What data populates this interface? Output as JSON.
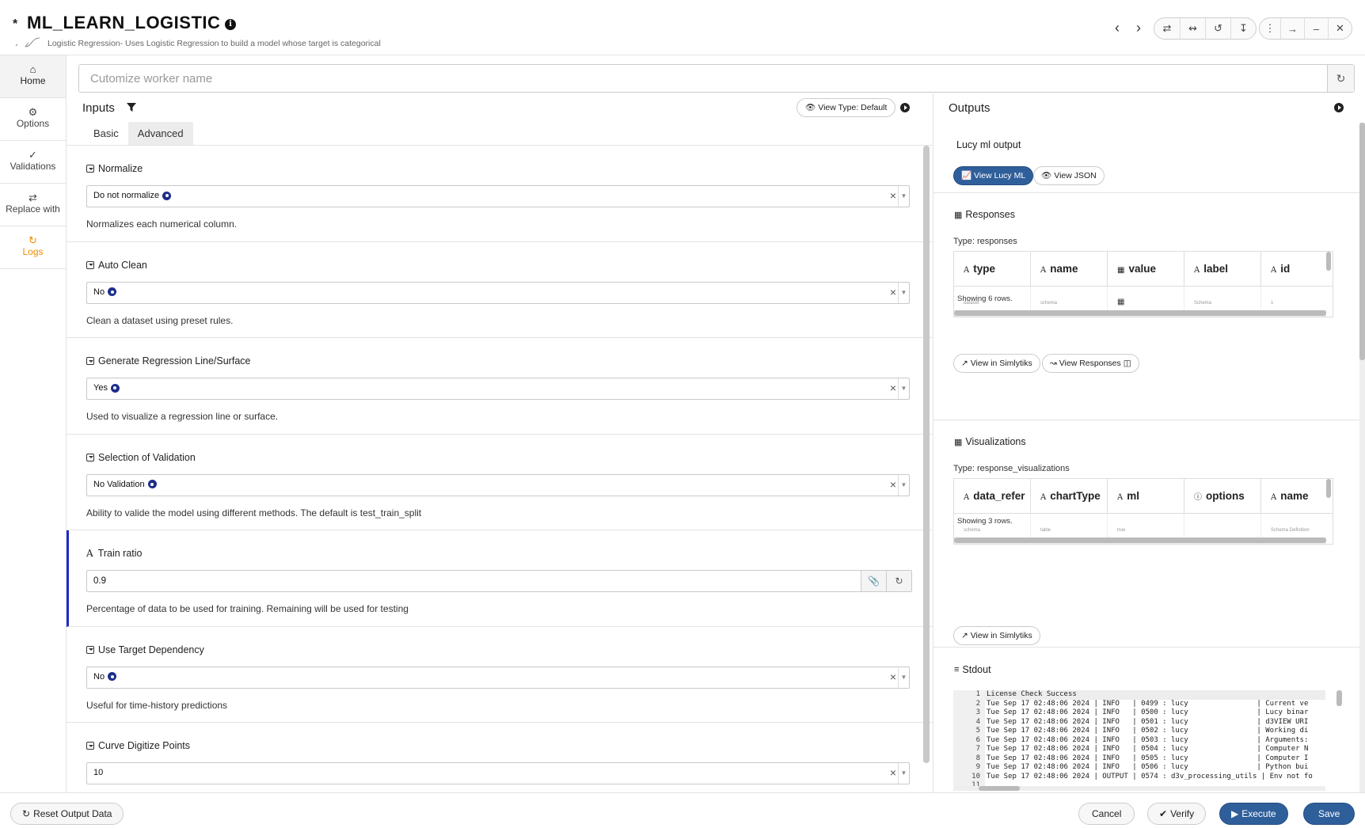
{
  "header": {
    "unsaved_marker": "*",
    "title": "ML_LEARN_LOGISTIC",
    "subtitle": "Logistic Regression- Uses Logistic Regression to build a model whose target is categorical"
  },
  "sidebar": {
    "items": [
      {
        "label": "Home",
        "icon": "home-icon"
      },
      {
        "label": "Options",
        "icon": "gear-icon"
      },
      {
        "label": "Validations",
        "icon": "check-double-icon"
      },
      {
        "label": "Replace with",
        "icon": "swap-icon"
      },
      {
        "label": "Logs",
        "icon": "history-icon",
        "color": "#f08c00"
      }
    ]
  },
  "worker": {
    "placeholder": "Cutomize worker name",
    "value": ""
  },
  "inputs": {
    "title": "Inputs",
    "view_type_label": "View Type: Default",
    "tabs": [
      {
        "label": "Basic",
        "active": false
      },
      {
        "label": "Advanced",
        "active": true
      }
    ],
    "fields": [
      {
        "label": "Normalize",
        "value": "Do not normalize",
        "help": "Normalizes each numerical column."
      },
      {
        "label": "Auto Clean",
        "value": "No",
        "help": "Clean a dataset using preset rules."
      },
      {
        "label": "Generate Regression Line/Surface",
        "value": "Yes",
        "help": "Used to visualize a regression line or surface."
      },
      {
        "label": "Selection of Validation",
        "value": "No Validation",
        "help": "Ability to valide the model using different methods. The default is test_train_split"
      },
      {
        "label": "Train ratio",
        "value": "0.9",
        "help": "Percentage of data to be used for training. Remaining will be used for testing"
      },
      {
        "label": "Use Target Dependency",
        "value": "No",
        "help": "Useful for time-history predictions"
      },
      {
        "label": "Curve Digitize Points",
        "value": "10",
        "help": ""
      }
    ]
  },
  "outputs": {
    "title": "Outputs",
    "lucy": {
      "title": "Lucy ml output",
      "view_lucy_label": "View Lucy ML",
      "view_json_label": "View JSON"
    },
    "responses": {
      "title": "Responses",
      "type_text": "Type: responses",
      "columns": [
        "type",
        "name",
        "value",
        "label",
        "id"
      ],
      "row": [
        "dataset",
        "schema",
        "",
        "Schema",
        "1"
      ],
      "showing": "Showing 6 rows.",
      "view_simlytiks_label": "View in Simlytiks",
      "view_responses_label": "View Responses"
    },
    "visualizations": {
      "title": "Visualizations",
      "type_text": "Type: response_visualizations",
      "columns": [
        "data_refer",
        "chartType",
        "ml",
        "options",
        "name"
      ],
      "row": [
        "schema",
        "table",
        "true",
        "",
        "Schema Definition"
      ],
      "showing": "Showing 3 rows.",
      "view_simlytiks_label": "View in Simlytiks"
    },
    "stdout": {
      "title": "Stdout",
      "lines": [
        "License Check Success",
        "Tue Sep 17 02:48:06 2024 | INFO   | 0499 : lucy                | Current ve",
        "Tue Sep 17 02:48:06 2024 | INFO   | 0500 : lucy                | Lucy binar",
        "Tue Sep 17 02:48:06 2024 | INFO   | 0501 : lucy                | d3VIEW URI",
        "Tue Sep 17 02:48:06 2024 | INFO   | 0502 : lucy                | Working di",
        "Tue Sep 17 02:48:06 2024 | INFO   | 0503 : lucy                | Arguments:",
        "Tue Sep 17 02:48:06 2024 | INFO   | 0504 : lucy                | Computer N",
        "Tue Sep 17 02:48:06 2024 | INFO   | 0505 : lucy                | Computer I",
        "Tue Sep 17 02:48:06 2024 | INFO   | 0506 : lucy                | Python bui",
        "Tue Sep 17 02:48:06 2024 | OUTPUT | 0574 : d3v_processing_utils | Env not fo",
        ""
      ]
    }
  },
  "footer": {
    "reset_label": "Reset Output Data",
    "cancel_label": "Cancel",
    "verify_label": "Verify",
    "execute_label": "Execute",
    "save_label": "Save"
  },
  "colors": {
    "primary": "#2f5f9b",
    "accent_orange": "#f08c00",
    "highlight_border": "#1f2bc9",
    "dot": "#1d2e8c"
  }
}
